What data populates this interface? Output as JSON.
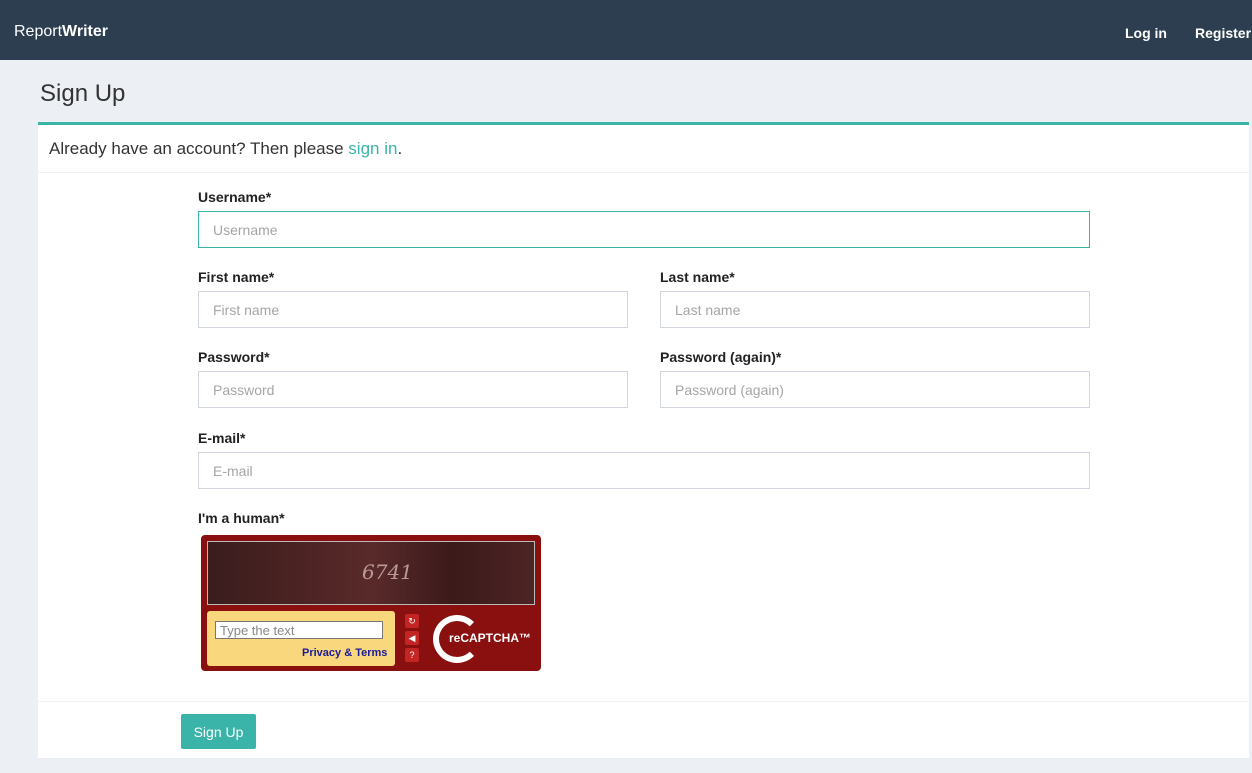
{
  "header": {
    "brand_part1": "Report",
    "brand_part2": "Writer",
    "nav_login": "Log in",
    "nav_register": "Register"
  },
  "page": {
    "title": "Sign Up"
  },
  "signin_prompt": {
    "text_before": "Already have an account? Then please ",
    "link": "sign in",
    "text_after": "."
  },
  "form": {
    "username": {
      "label": "Username*",
      "placeholder": "Username"
    },
    "first_name": {
      "label": "First name*",
      "placeholder": "First name"
    },
    "last_name": {
      "label": "Last name*",
      "placeholder": "Last name"
    },
    "password": {
      "label": "Password*",
      "placeholder": "Password"
    },
    "password_again": {
      "label": "Password (again)*",
      "placeholder": "Password (again)"
    },
    "email": {
      "label": "E-mail*",
      "placeholder": "E-mail"
    },
    "captcha": {
      "label": "I'm a human*",
      "challenge_text": "6741",
      "input_placeholder": "Type the text",
      "privacy_link": "Privacy & Terms",
      "logo_text": "reCAPTCHA™"
    },
    "submit_label": "Sign Up"
  },
  "colors": {
    "accent": "#3ab4a8",
    "header_bg": "#2c3e50",
    "captcha_bg": "#8a0f0f"
  }
}
